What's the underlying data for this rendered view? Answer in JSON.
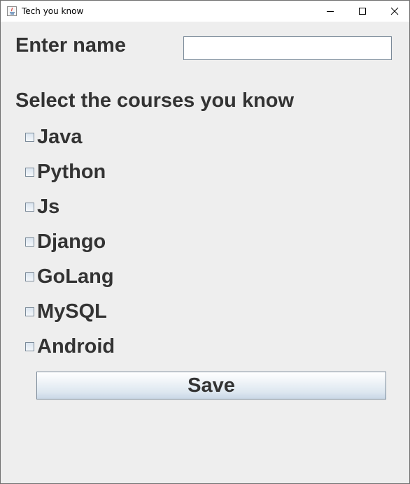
{
  "window": {
    "title": "Tech you know",
    "controls": [
      "minimize-icon",
      "maximize-icon",
      "close-icon"
    ]
  },
  "form": {
    "name_label": "Enter name",
    "name_value": "",
    "courses_heading": "Select the courses you know",
    "courses": [
      {
        "label": "Java",
        "checked": false
      },
      {
        "label": "Python",
        "checked": false
      },
      {
        "label": "Js",
        "checked": false
      },
      {
        "label": "Django",
        "checked": false
      },
      {
        "label": "GoLang",
        "checked": false
      },
      {
        "label": "MySQL",
        "checked": false
      },
      {
        "label": "Android",
        "checked": false
      }
    ],
    "save_label": "Save"
  },
  "colors": {
    "background": "#eeeeee",
    "text": "#333333",
    "border": "#7a8a99"
  }
}
